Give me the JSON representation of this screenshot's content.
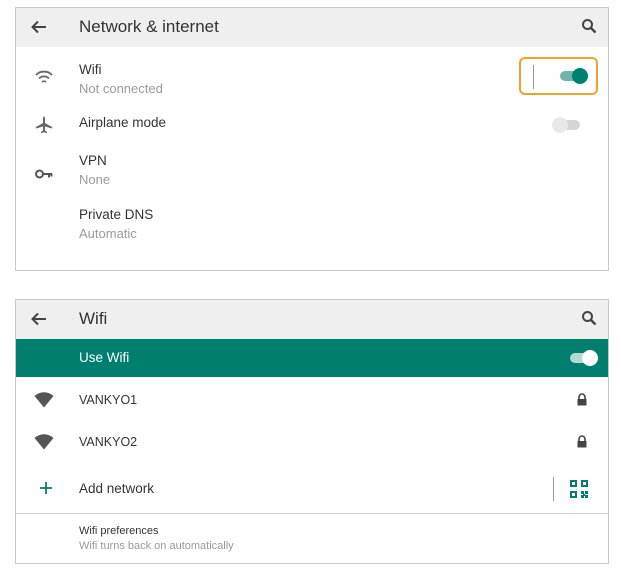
{
  "network_screen": {
    "title": "Network & internet",
    "items": [
      {
        "name": "Wifi",
        "status": "Not connected",
        "icon": "wifi-icon",
        "toggle": "on"
      },
      {
        "name": "Airplane mode",
        "icon": "airplane-icon",
        "toggle": "off"
      },
      {
        "name": "VPN",
        "status": "None",
        "icon": "key-icon"
      },
      {
        "name": "Private DNS",
        "status": "Automatic"
      }
    ]
  },
  "wifi_screen": {
    "title": "Wifi",
    "use_wifi_label": "Use Wifi",
    "use_wifi_enabled": true,
    "networks": [
      {
        "ssid": "VANKYO1",
        "secured": true
      },
      {
        "ssid": "VANKYO2",
        "secured": true
      }
    ],
    "add_network_label": "Add network",
    "preferences": {
      "title": "Wifi preferences",
      "subtitle": "Wifi turns back on automatically"
    }
  },
  "colors": {
    "accent": "#007e6e",
    "highlight": "#f0a030",
    "appbar": "#efefef"
  }
}
